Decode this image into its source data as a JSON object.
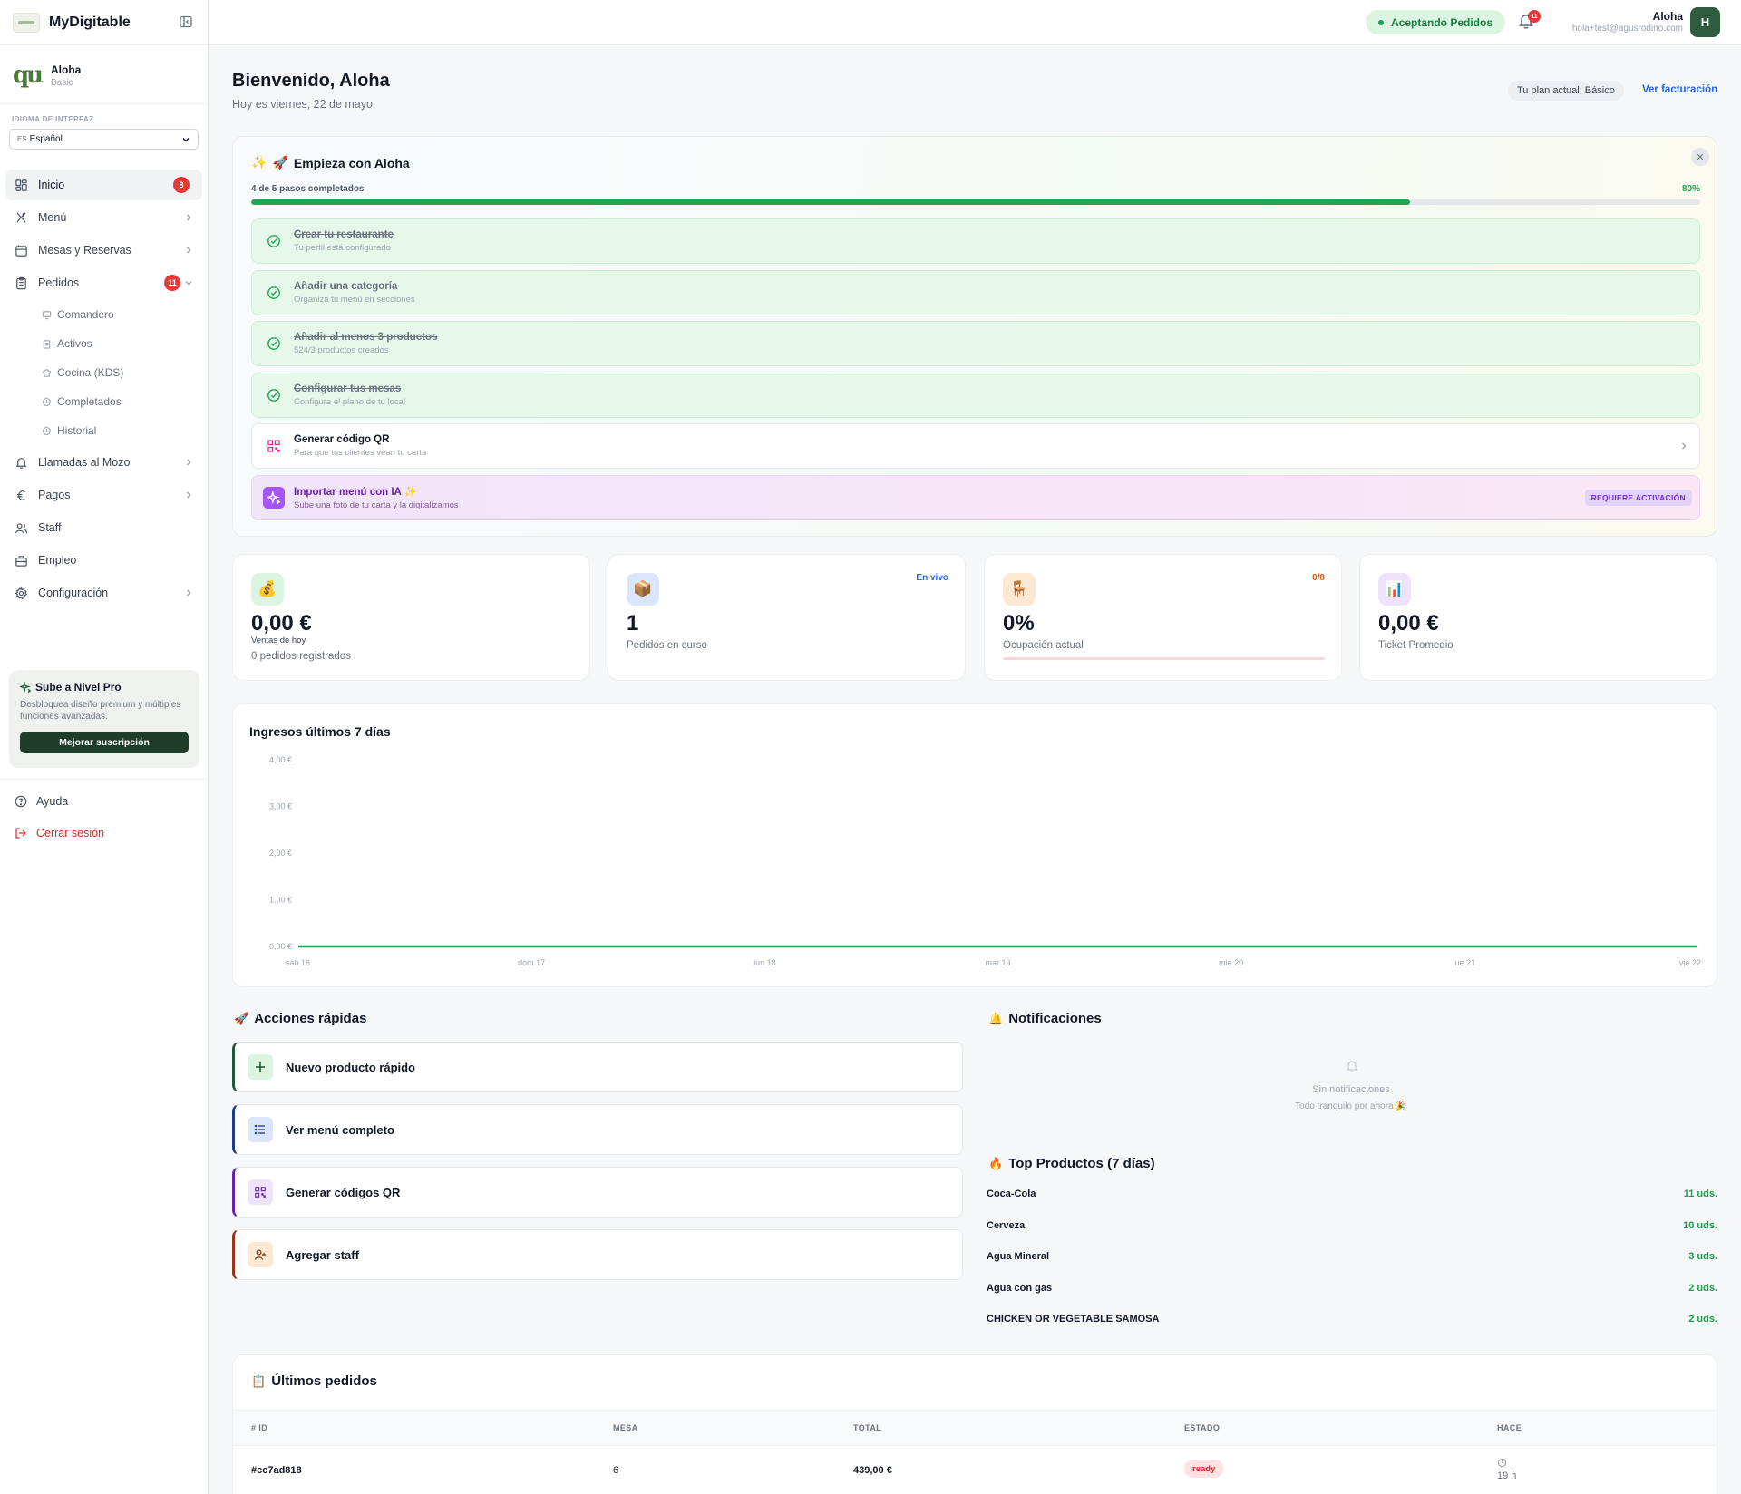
{
  "brand": {
    "name": "MyDigitable"
  },
  "account": {
    "name": "Aloha",
    "plan": "Basic"
  },
  "language": {
    "label": "IDIOMA DE INTERFAZ",
    "selected": "Español",
    "flag": "ES"
  },
  "nav": [
    {
      "label": "Inicio",
      "badge": "8",
      "icon": "dashboard-icon"
    },
    {
      "label": "Menú",
      "icon": "utensils-icon"
    },
    {
      "label": "Mesas y Reservas",
      "icon": "calendar-icon"
    },
    {
      "label": "Pedidos",
      "badge": "11",
      "icon": "clipboard-icon"
    }
  ],
  "subnav": [
    "Comandero",
    "Activos",
    "Cocina (KDS)",
    "Completados",
    "Historial"
  ],
  "nav2": [
    {
      "label": "Llamadas al Mozo",
      "icon": "bell-icon"
    },
    {
      "label": "Pagos",
      "icon": "euro-icon"
    },
    {
      "label": "Staff",
      "icon": "users-icon"
    },
    {
      "label": "Empleo",
      "icon": "briefcase-icon"
    },
    {
      "label": "Configuración",
      "icon": "gear-icon"
    }
  ],
  "promo": {
    "title": "Sube a Nivel Pro",
    "text": "Desbloquea diseño premium y múltiples funciones avanzadas.",
    "button": "Mejorar suscripción"
  },
  "footer": {
    "help": "Ayuda",
    "logout": "Cerrar sesión"
  },
  "topbar": {
    "status": "Aceptando Pedidos",
    "notif_count": "11",
    "user_name": "Aloha",
    "user_email": "hola+test@agusrodino.com",
    "avatar": "H"
  },
  "header": {
    "welcome": "Bienvenido, Aloha",
    "date": "Hoy es viernes, 22 de mayo",
    "plan": "Tu plan actual: Básico",
    "billing": "Ver facturación"
  },
  "onboarding": {
    "title": "Empieza con Aloha",
    "progress_label": "4 de 5 pasos completados",
    "progress_pct": "80%",
    "progress_value": 0.8,
    "steps": [
      {
        "title": "Crear tu restaurante",
        "sub": "Tu perfil está configurado"
      },
      {
        "title": "Añadir una categoría",
        "sub": "Organiza tu menú en secciones"
      },
      {
        "title": "Añadir al menos 3 productos",
        "sub": "524/3 productos creados"
      },
      {
        "title": "Configurar tus mesas",
        "sub": "Configura el plano de tu local"
      },
      {
        "title": "Generar código QR",
        "sub": "Para que tus clientes vean tu carta"
      },
      {
        "title": "Importar menú con IA ✨",
        "sub": "Sube una foto de tu carta y la digitalizamos",
        "badge": "REQUIERE ACTIVACIÓN"
      }
    ]
  },
  "stats": [
    {
      "value": "0,00 €",
      "label": "Ventas de hoy",
      "sub": "0 pedidos registrados",
      "emoji": "💰"
    },
    {
      "value": "1",
      "label": "Pedidos en curso",
      "tag": "En vivo",
      "emoji": "📦"
    },
    {
      "value": "0%",
      "label": "Ocupación actual",
      "tag": "0/8",
      "emoji": "🪑",
      "occupancy": 0
    },
    {
      "value": "0,00 €",
      "label": "Ticket Promedio",
      "emoji": "📊"
    }
  ],
  "chart_data": {
    "type": "area",
    "title": "Ingresos últimos 7 días",
    "categories": [
      "sáb 16",
      "dom 17",
      "lun 18",
      "mar 19",
      "mié 20",
      "jue 21",
      "vie 22"
    ],
    "values": [
      0,
      0,
      0,
      0,
      0,
      0,
      0
    ],
    "yticks": [
      "0,00 €",
      "1,00 €",
      "2,00 €",
      "3,00 €",
      "4,00 €"
    ],
    "ylim": [
      0,
      4
    ],
    "color": "#22a455"
  },
  "quick_actions": {
    "title": "Acciones rápidas",
    "items": [
      {
        "label": "Nuevo producto rápido",
        "icon": "plus-icon",
        "color": "#1f5a37",
        "bg": "#dcf5e3"
      },
      {
        "label": "Ver menú completo",
        "icon": "list-icon",
        "color": "#1e3a8a",
        "bg": "#dbe6fb"
      },
      {
        "label": "Generar códigos QR",
        "icon": "qr-icon",
        "color": "#6b21a8",
        "bg": "#efe3fb"
      },
      {
        "label": "Agregar staff",
        "icon": "user-plus-icon",
        "color": "#9a3412",
        "bg": "#fde8d2"
      }
    ]
  },
  "notifications": {
    "title": "Notificaciones",
    "empty": "Sin notificaciones",
    "empty_sub": "Todo tranquilo por ahora 🎉"
  },
  "top_products": {
    "title": "Top Productos (7 días)",
    "items": [
      {
        "name": "Coca-Cola",
        "qty": "11 uds."
      },
      {
        "name": "Cerveza",
        "qty": "10 uds."
      },
      {
        "name": "Agua Mineral",
        "qty": "3 uds."
      },
      {
        "name": "Agua con gas",
        "qty": "2 uds."
      },
      {
        "name": "CHICKEN OR VEGETABLE SAMOSA",
        "qty": "2 uds."
      }
    ]
  },
  "orders": {
    "title": "Últimos pedidos",
    "columns": [
      "# ID",
      "MESA",
      "TOTAL",
      "ESTADO",
      "HACE"
    ],
    "rows": [
      {
        "id": "#cc7ad818",
        "mesa": "6",
        "total": "439,00 €",
        "estado": "ready",
        "hace": "19 h"
      }
    ]
  }
}
